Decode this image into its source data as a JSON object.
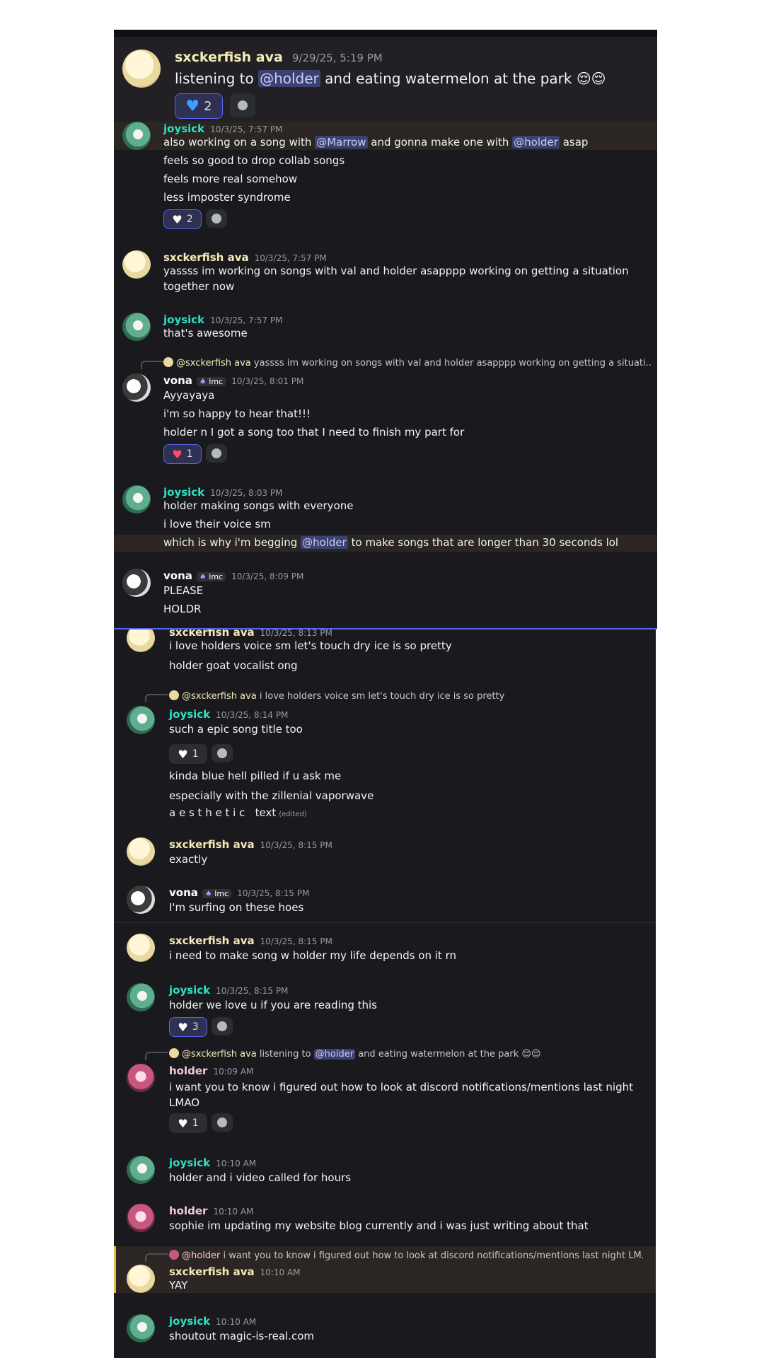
{
  "s1": {
    "name": "sxckerfish ava",
    "time": "9/29/25, 5:19 PM",
    "pre": "listening to ",
    "mention": "@holder",
    "post": " and eating watermelon at the park ",
    "emoji": "😌😌",
    "react_count": "2"
  },
  "s2": {
    "m1": {
      "name": "joysick",
      "time": "10/3/25, 7:57 PM",
      "l1a": "also working on a song with ",
      "l1m1": "@Marrow",
      "l1b": " and gonna make one with ",
      "l1m2": "@holder",
      "l1c": " asap",
      "l2": "feels so good to drop collab songs",
      "l3": "feels more real somehow",
      "l4": "less imposter syndrome",
      "react_count": "2"
    },
    "m2": {
      "name": "sxckerfish ava",
      "time": "10/3/25, 7:57 PM",
      "l1": "yassss im working on songs with val and holder asapppp working on getting a situation",
      "l2": "together now"
    },
    "m3": {
      "name": "joysick",
      "time": "10/3/25, 7:57 PM",
      "l1": "that's awesome"
    },
    "m4": {
      "reply_name": "@sxckerfish ava",
      "reply_text": "yassss im working on songs with val and holder asapppp working on getting a situati...",
      "name": "vona",
      "tag": "lmc",
      "time": "10/3/25, 8:01 PM",
      "l1": "Ayyayaya",
      "l2": "i'm so happy to hear that!!!",
      "l3": "holder n I got a song too that I need to finish my part for",
      "react_count": "1"
    },
    "m5": {
      "name": "joysick",
      "time": "10/3/25, 8:03 PM",
      "l1": "holder making songs with everyone",
      "l2": "i love their voice sm",
      "l3a": "which is why i'm begging ",
      "l3m": "@holder",
      "l3b": " to make songs that are longer than 30 seconds lol"
    },
    "m6": {
      "name": "vona",
      "tag": "lmc",
      "time": "10/3/25, 8:09 PM",
      "l1": "PLEASE",
      "l2": "HOLDR"
    }
  },
  "s3": {
    "m1": {
      "name": "sxckerfish ava",
      "time": "10/3/25, 8:13 PM",
      "l1": "i love holders voice sm let's touch dry ice is so pretty",
      "l2": "holder goat vocalist ong"
    },
    "m2": {
      "reply_name": "@sxckerfish ava",
      "reply_text": "i love holders voice sm let's touch dry ice is so pretty",
      "name": "joysick",
      "time": "10/3/25, 8:14 PM",
      "l1": "such a epic song title too",
      "react_count": "1",
      "l2": "kinda blue hell pilled if u ask me",
      "l3": "especially with the zillenial vaporwave",
      "l4": "a e s t h e t i c   text",
      "edited": "(edited)"
    },
    "m3": {
      "name": "sxckerfish ava",
      "time": "10/3/25, 8:15 PM",
      "l1": "exactly"
    },
    "m4": {
      "name": "vona",
      "tag": "lmc",
      "time": "10/3/25, 8:15 PM",
      "l1": "I'm surfing on these hoes"
    },
    "m5": {
      "name": "sxckerfish ava",
      "time": "10/3/25, 8:15 PM",
      "l1": "i need to make song w holder my life depends on it rn"
    },
    "m6": {
      "name": "joysick",
      "time": "10/3/25, 8:15 PM",
      "l1": "holder we love u if you are reading this",
      "react_count": "3"
    },
    "m7": {
      "reply_name": "@sxckerfish ava",
      "reply_pre": "listening to ",
      "reply_mention": "@holder",
      "reply_post": " and eating watermelon at the park ",
      "reply_emoji": "😌😌",
      "name": "holder",
      "time": "10:09 AM",
      "l1": "i want you to know i figured out how to look at discord notifications/mentions last night",
      "l2": "LMAO",
      "react_count": "1"
    },
    "m8": {
      "name": "joysick",
      "time": "10:10 AM",
      "l1": "holder and i video called for hours"
    },
    "m9": {
      "name": "holder",
      "time": "10:10 AM",
      "l1": "sophie im updating my website blog currently and i was just writing about that"
    },
    "m10": {
      "reply_name": "@holder",
      "reply_text": "i want you to know i figured out how to look at discord notifications/mentions last night LM...",
      "name": "sxckerfish ava",
      "time": "10:10 AM",
      "l1": "YAY"
    },
    "m11": {
      "name": "joysick",
      "time": "10:10 AM",
      "l1": "shoutout magic-is-real.com"
    }
  },
  "icons": {
    "heart": "♥",
    "smiley": "add-reaction-icon",
    "role": "mushroom-icon"
  },
  "colors": {
    "bg": "#1a1a1e",
    "mention": "#3c4270",
    "blurple": "#5865f2",
    "joysick": "#2de0c6",
    "sxckerfish": "#f4ecb8"
  }
}
